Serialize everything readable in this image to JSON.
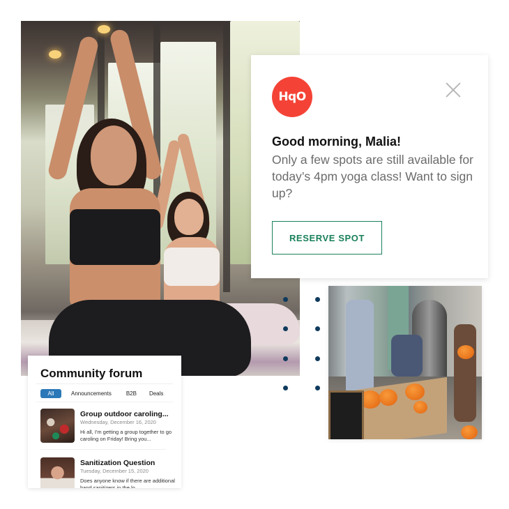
{
  "notification": {
    "logo_text": "HqO",
    "greeting": "Good morning, Malia!",
    "message": "Only a few spots are still available for today’s 4pm yoga class! Want to sign up?",
    "button_label": "RESERVE SPOT",
    "close_icon": "close-icon",
    "colors": {
      "logo": "#f44336",
      "button": "#19805a"
    }
  },
  "forum": {
    "title": "Community forum",
    "tabs": [
      {
        "label": "All",
        "active": true
      },
      {
        "label": "Announcements",
        "active": false
      },
      {
        "label": "B2B",
        "active": false
      },
      {
        "label": "Deals",
        "active": false
      }
    ],
    "posts": [
      {
        "title": "Group outdoor caroling...",
        "date": "Wednesday, December 16, 2020",
        "body": "Hi all, I'm getting a group together to go caroling on Friday! Bring you..."
      },
      {
        "title": "Sanitization Question",
        "date": "Tuesday, December 15, 2020",
        "body": "Does anyone know if there are additional hand sanitizers in the lo..."
      }
    ],
    "colors": {
      "active_tab": "#2b78b8"
    }
  },
  "images": {
    "yoga": "yoga-class-photo",
    "pumpkin": "pumpkin-event-photo"
  },
  "decor": {
    "dot_color": "#0f3a5c"
  }
}
